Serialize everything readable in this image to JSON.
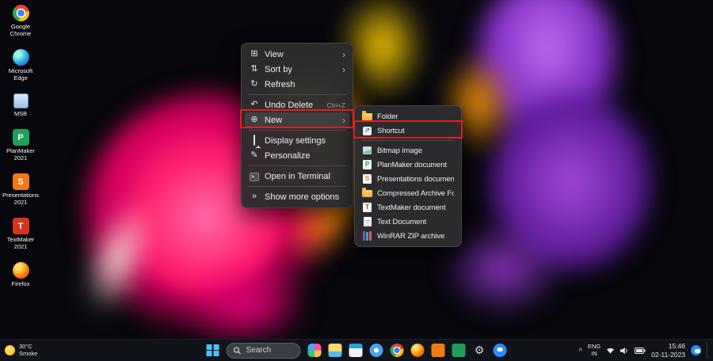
{
  "annotation": {
    "color": "#e11f1f"
  },
  "desktop_icons": [
    {
      "label": "Google Chrome"
    },
    {
      "label": "Microsoft Edge"
    },
    {
      "label": "MSB"
    },
    {
      "label": "PlanMaker 2021",
      "glyph": "P"
    },
    {
      "label": "Presentations 2021",
      "glyph": "S"
    },
    {
      "label": "TextMaker 2021",
      "glyph": "T"
    },
    {
      "label": "Firefox"
    }
  ],
  "context_menu": {
    "items": [
      {
        "label": "View",
        "icon": "view-icon",
        "icon_glyph": "⊞",
        "has_submenu": true
      },
      {
        "label": "Sort by",
        "icon": "sort-icon",
        "icon_glyph": "⇅",
        "has_submenu": true
      },
      {
        "label": "Refresh",
        "icon": "refresh-icon",
        "icon_glyph": "↻"
      },
      {
        "label": "Undo Delete",
        "icon": "undo-icon",
        "icon_glyph": "↶",
        "shortcut": "Ctrl+Z"
      },
      {
        "label": "New",
        "icon": "new-icon",
        "icon_glyph": "⊕",
        "has_submenu": true,
        "highlighted": true
      },
      {
        "label": "Display settings",
        "icon": "display-icon"
      },
      {
        "label": "Personalize",
        "icon": "personalize-icon",
        "icon_glyph": "✎"
      },
      {
        "label": "Open in Terminal",
        "icon": "terminal-icon",
        "icon_glyph": ">_"
      },
      {
        "label": "Show more options",
        "icon": "more-options-icon",
        "icon_glyph": "»"
      }
    ]
  },
  "new_submenu": {
    "items": [
      {
        "label": "Folder",
        "icon": "folder-icon"
      },
      {
        "label": "Shortcut",
        "icon": "shortcut-icon",
        "glyph": "↗",
        "highlighted": true
      },
      {
        "label": "Bitmap image",
        "icon": "bitmap-image-icon"
      },
      {
        "label": "PlanMaker document",
        "icon": "planmaker-document-icon",
        "glyph": "P"
      },
      {
        "label": "Presentations document",
        "icon": "presentations-document-icon",
        "glyph": "S"
      },
      {
        "label": "Compressed Archive Folder",
        "icon": "compressed-archive-icon"
      },
      {
        "label": "TextMaker document",
        "icon": "textmaker-document-icon",
        "glyph": "T"
      },
      {
        "label": "Text Document",
        "icon": "text-document-icon"
      },
      {
        "label": "WinRAR ZIP archive",
        "icon": "winrar-icon"
      }
    ]
  },
  "taskbar": {
    "weather": {
      "temperature": "30°C",
      "condition": "Smoke"
    },
    "search": {
      "placeholder": "Search"
    },
    "tray": {
      "language": "ENG",
      "region": "IN",
      "time": "15:46",
      "date": "02-11-2023"
    }
  }
}
